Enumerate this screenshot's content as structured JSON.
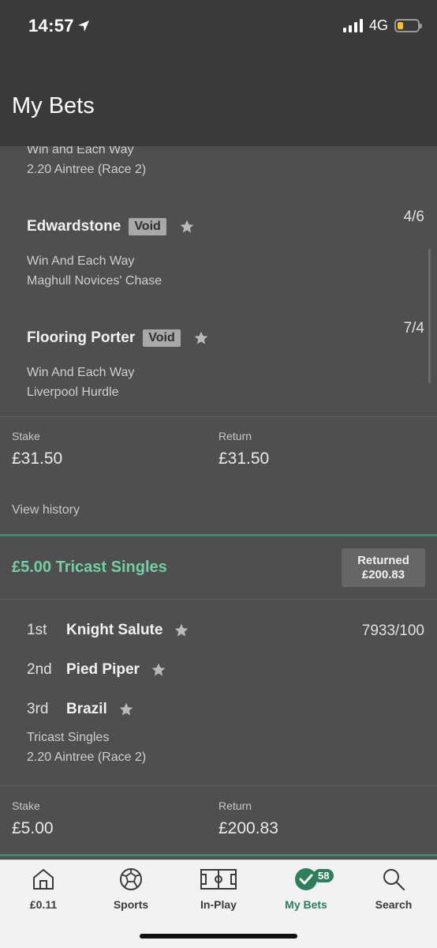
{
  "status_bar": {
    "time": "14:57",
    "network": "4G"
  },
  "header": {
    "title": "My Bets"
  },
  "bets": {
    "prev": {
      "top_market": "Win and Each Way",
      "top_event": "2.20 Aintree (Race 2)",
      "selections": [
        {
          "name": "Edwardstone",
          "badge": "Void",
          "odds": "4/6",
          "market": "Win And Each Way",
          "event": "Maghull Novices' Chase"
        },
        {
          "name": "Flooring Porter",
          "badge": "Void",
          "odds": "7/4",
          "market": "Win And Each Way",
          "event": "Liverpool Hurdle"
        }
      ],
      "stake_label": "Stake",
      "stake": "£31.50",
      "return_label": "Return",
      "return": "£31.50",
      "history_link": "View history"
    },
    "tricast": {
      "title": "£5.00 Tricast Singles",
      "returned_label": "Returned",
      "returned_amount": "£200.83",
      "odds": "7933/100",
      "places": [
        {
          "pos": "1st",
          "name": "Knight Salute"
        },
        {
          "pos": "2nd",
          "name": "Pied Piper"
        },
        {
          "pos": "3rd",
          "name": "Brazil"
        }
      ],
      "market": "Tricast Singles",
      "event": "2.20 Aintree (Race 2)",
      "stake_label": "Stake",
      "stake": "£5.00",
      "return_label": "Return",
      "return": "£200.83"
    }
  },
  "tabbar": {
    "items": [
      {
        "label": "£0.11",
        "icon": "home-icon"
      },
      {
        "label": "Sports",
        "icon": "football-icon"
      },
      {
        "label": "In-Play",
        "icon": "pitch-icon"
      },
      {
        "label": "My Bets",
        "icon": "check-circle-icon",
        "badge": "58"
      },
      {
        "label": "Search",
        "icon": "search-icon"
      }
    ]
  },
  "colors": {
    "accent": "#2e7d5b",
    "title_green": "#6fd1a3",
    "header_bg": "#3a3a3a",
    "content_bg": "#4f4f4f"
  }
}
